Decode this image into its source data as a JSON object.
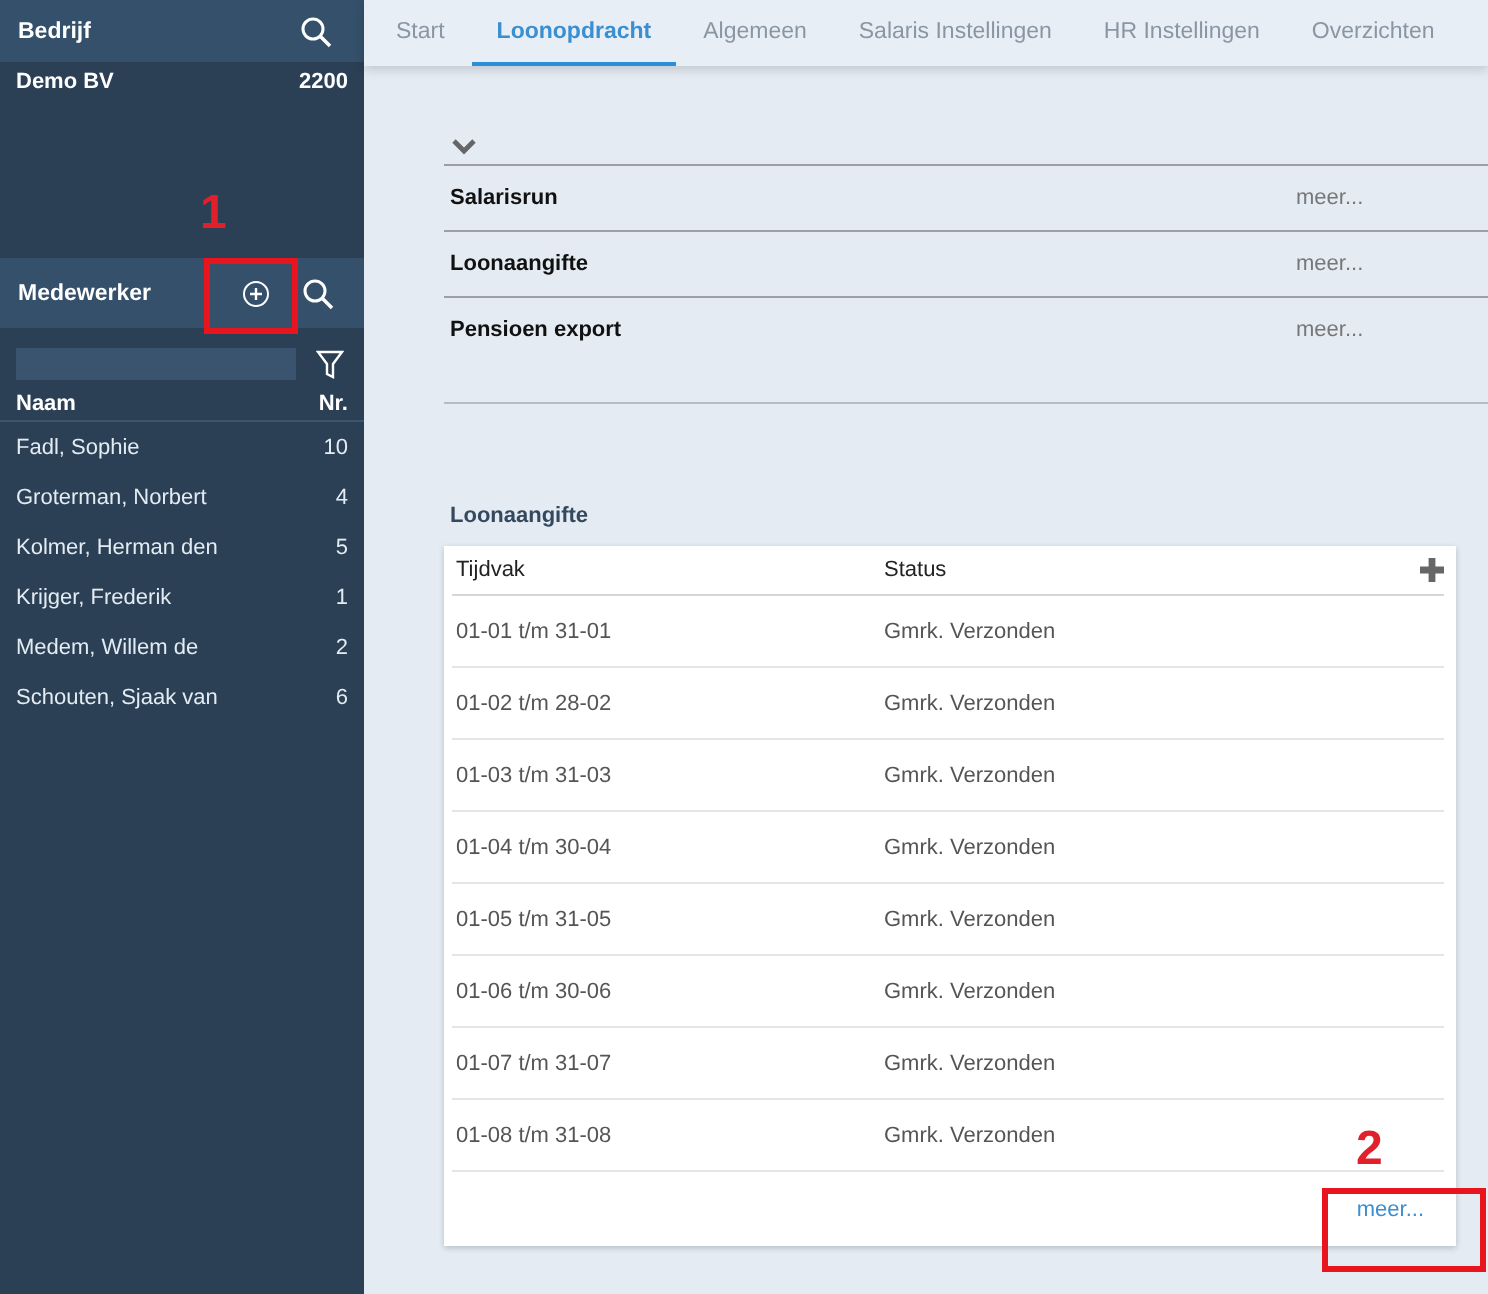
{
  "sidebar": {
    "company_header": {
      "title": "Bedrijf"
    },
    "company": {
      "name": "Demo BV",
      "number": "2200"
    },
    "employee_header": {
      "title": "Medewerker"
    },
    "columns": [
      "Naam",
      "Nr."
    ],
    "employees": [
      {
        "name": "Fadl, Sophie",
        "number": "10"
      },
      {
        "name": "Groterman, Norbert",
        "number": "4"
      },
      {
        "name": "Kolmer, Herman den",
        "number": "5"
      },
      {
        "name": "Krijger, Frederik",
        "number": "1"
      },
      {
        "name": "Medem, Willem de",
        "number": "2"
      },
      {
        "name": "Schouten, Sjaak van",
        "number": "6"
      }
    ]
  },
  "tabs": [
    {
      "label": "Start",
      "selected": false
    },
    {
      "label": "Loonopdracht",
      "selected": true
    },
    {
      "label": "Algemeen",
      "selected": false
    },
    {
      "label": "Salaris Instellingen",
      "selected": false
    },
    {
      "label": "HR Instellingen",
      "selected": false
    },
    {
      "label": "Overzichten",
      "selected": false
    }
  ],
  "sections": {
    "expanded": true,
    "items": [
      {
        "title": "Salarisrun",
        "link": "meer..."
      },
      {
        "title": "Loonaangifte",
        "link": "meer..."
      },
      {
        "title": "Pensioen export",
        "link": "meer..."
      }
    ]
  },
  "panel": {
    "title": "Loonaangifte",
    "columns": [
      "Tijdvak",
      "Status"
    ],
    "rows": [
      {
        "period": "01-01 t/m 31-01",
        "status": "Gmrk. Verzonden"
      },
      {
        "period": "01-02 t/m 28-02",
        "status": "Gmrk. Verzonden"
      },
      {
        "period": "01-03 t/m 31-03",
        "status": "Gmrk. Verzonden"
      },
      {
        "period": "01-04 t/m 30-04",
        "status": "Gmrk. Verzonden"
      },
      {
        "period": "01-05 t/m 31-05",
        "status": "Gmrk. Verzonden"
      },
      {
        "period": "01-06 t/m 30-06",
        "status": "Gmrk. Verzonden"
      },
      {
        "period": "01-07 t/m 31-07",
        "status": "Gmrk. Verzonden"
      },
      {
        "period": "01-08 t/m 31-08",
        "status": "Gmrk. Verzonden"
      }
    ],
    "link": "meer..."
  },
  "callouts": [
    "1",
    "2"
  ]
}
